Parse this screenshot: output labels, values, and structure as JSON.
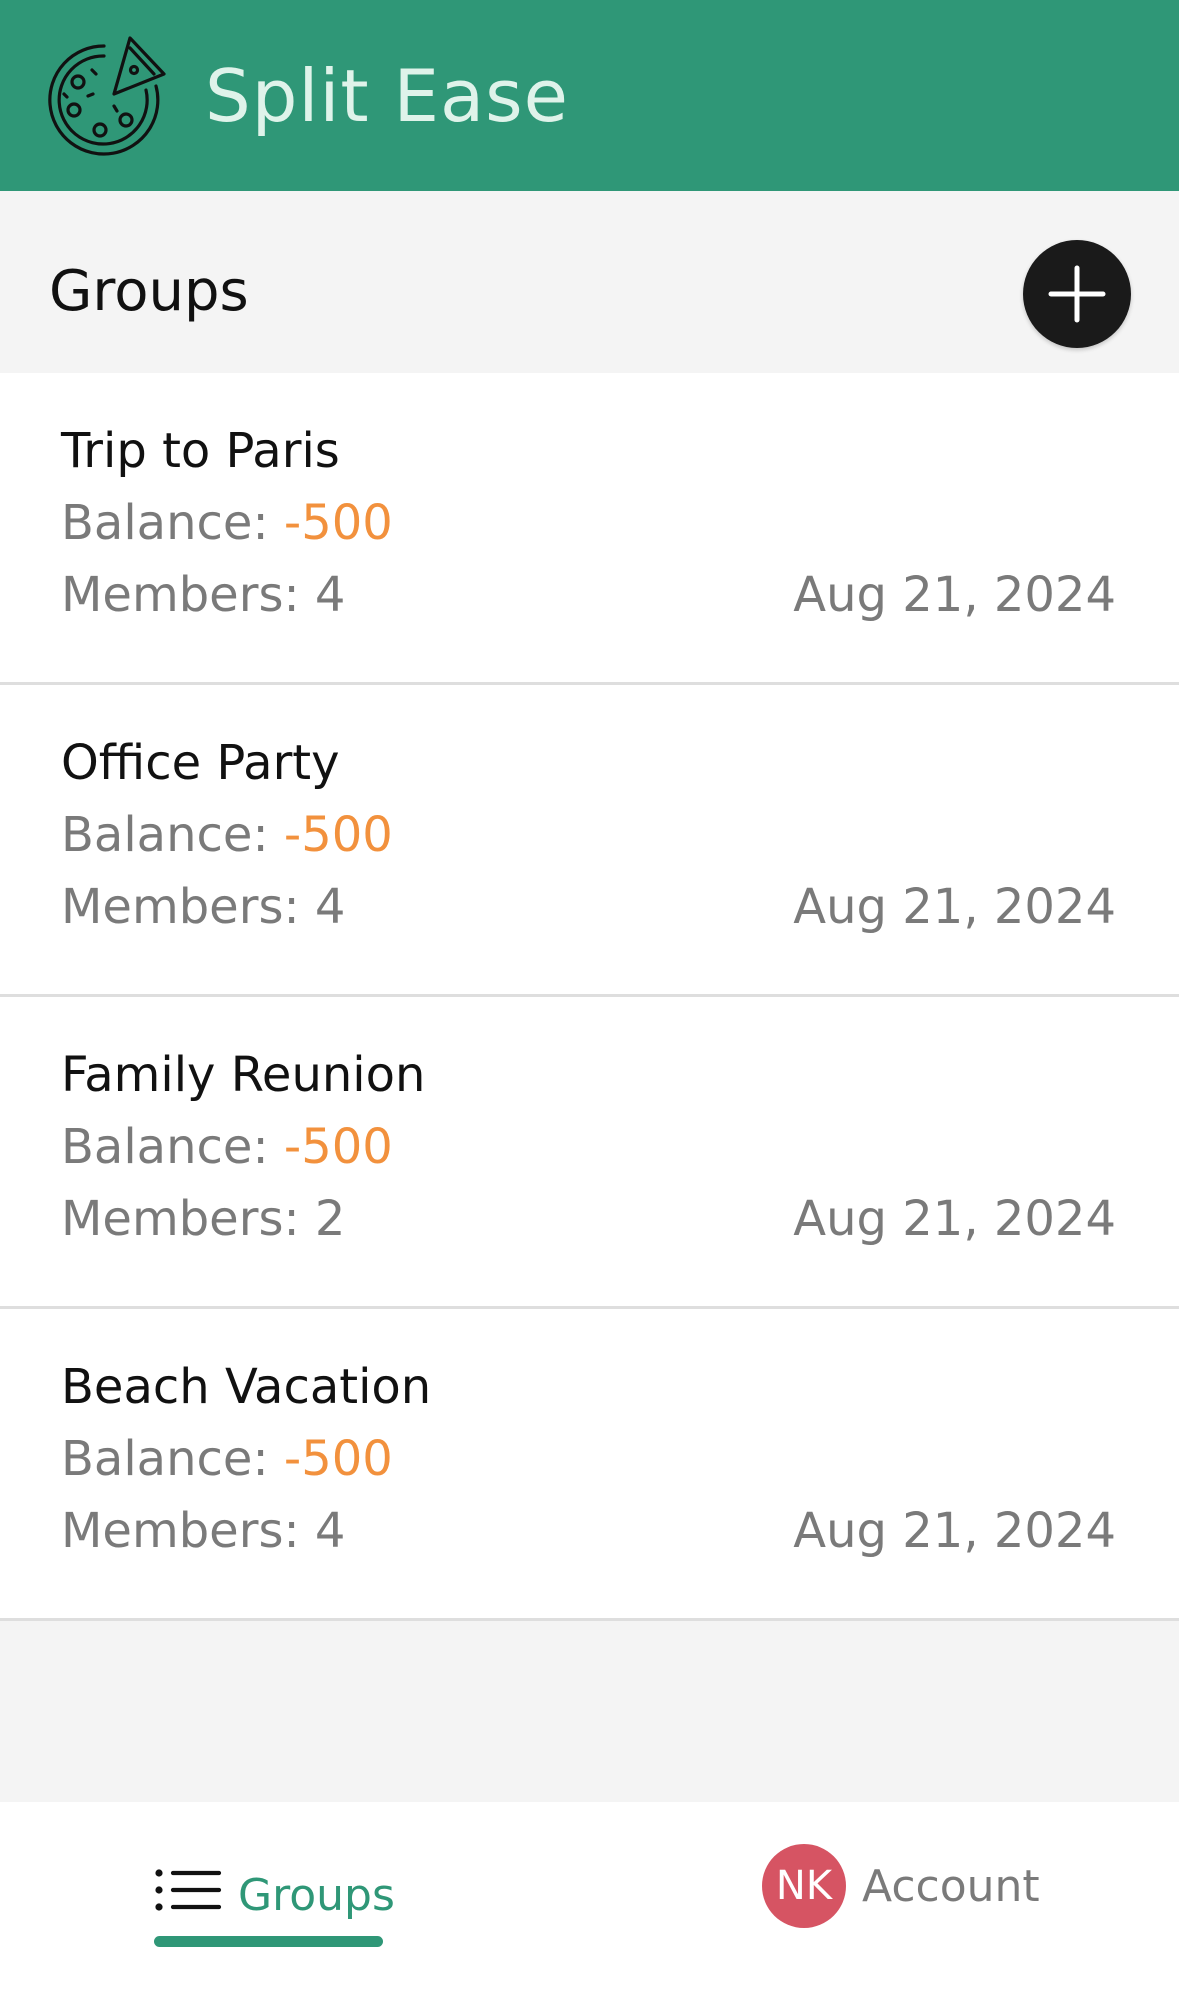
{
  "app": {
    "title": "Split Ease",
    "header_color": "#2f9777",
    "logo_icon": "pizza-icon"
  },
  "groups_section": {
    "title": "Groups",
    "add_icon": "plus-icon"
  },
  "groups": [
    {
      "name": "Trip to Paris",
      "balance_label": "Balance:",
      "balance_value": "-500",
      "members_text": "Members: 4",
      "date": "Aug 21, 2024"
    },
    {
      "name": "Office Party",
      "balance_label": "Balance:",
      "balance_value": "-500",
      "members_text": "Members: 4",
      "date": "Aug 21, 2024"
    },
    {
      "name": "Family Reunion",
      "balance_label": "Balance:",
      "balance_value": "-500",
      "members_text": "Members: 2",
      "date": "Aug 21, 2024"
    },
    {
      "name": "Beach Vacation",
      "balance_label": "Balance:",
      "balance_value": "-500",
      "members_text": "Members: 4",
      "date": "Aug 21, 2024"
    }
  ],
  "bottom_nav": {
    "groups_label": "Groups",
    "groups_icon": "list-icon",
    "account_label": "Account",
    "account_initials": "NK",
    "active_color": "#2f9777",
    "avatar_color": "#d65463",
    "balance_color": "#f2913d"
  }
}
